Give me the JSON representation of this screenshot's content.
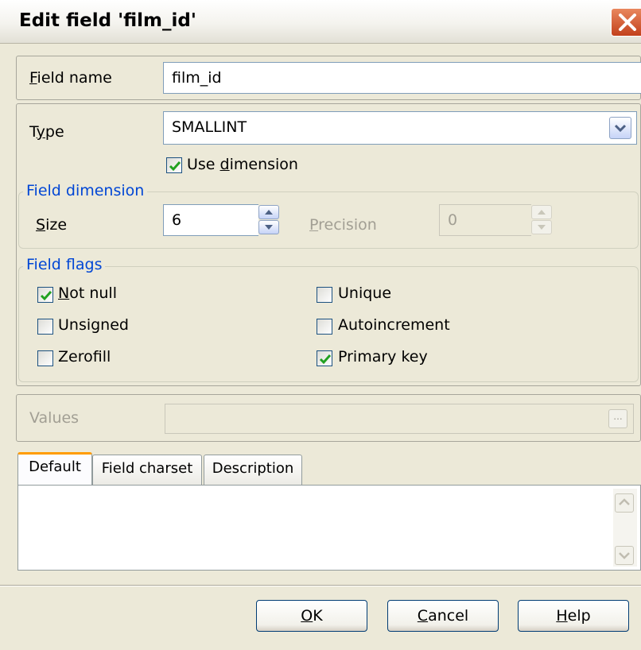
{
  "window": {
    "title": "Edit field 'film_id'"
  },
  "field_name": {
    "label_u": "F",
    "label_rest": "ield name",
    "value": "film_id"
  },
  "type": {
    "label_pre": "T",
    "label_u": "y",
    "label_rest": "pe",
    "value": "SMALLINT"
  },
  "use_dimension": {
    "label_pre": "Use ",
    "label_u": "d",
    "label_rest": "imension",
    "checked": true
  },
  "field_dimension": {
    "legend": "Field dimension",
    "size": {
      "label_u": "S",
      "label_rest": "ize",
      "value": "6"
    },
    "precision": {
      "label_u": "P",
      "label_rest": "recision",
      "value": "0",
      "enabled": false
    }
  },
  "field_flags": {
    "legend": "Field flags",
    "not_null": {
      "label_u": "N",
      "label_rest": "ot null",
      "checked": true
    },
    "unsigned": {
      "label": "Unsigned",
      "checked": false
    },
    "zerofill": {
      "label": "Zerofill",
      "checked": false
    },
    "unique": {
      "label": "Unique",
      "checked": false
    },
    "autoincrement": {
      "label": "Autoincrement",
      "checked": false
    },
    "primary_key": {
      "label": "Primary key",
      "checked": true
    }
  },
  "values": {
    "label": "Values",
    "value": "",
    "button": "..."
  },
  "tabs": [
    {
      "label": "Default",
      "active": true
    },
    {
      "label": "Field charset",
      "active": false
    },
    {
      "label": "Description",
      "active": false
    }
  ],
  "buttons": {
    "ok": {
      "label_u": "O",
      "label_rest": "K"
    },
    "cancel": {
      "label_u": "C",
      "label_rest": "ancel"
    },
    "help": {
      "label_u": "H",
      "label_rest": "elp"
    }
  },
  "colors": {
    "accent": "#0046d5",
    "tab_highlight": "#ff9c00",
    "close_button": "#c2411c"
  },
  "icons": [
    "close-icon",
    "chevron-down-icon",
    "check-icon",
    "spin-up-icon",
    "spin-down-icon",
    "scroll-up-icon",
    "scroll-down-icon"
  ]
}
